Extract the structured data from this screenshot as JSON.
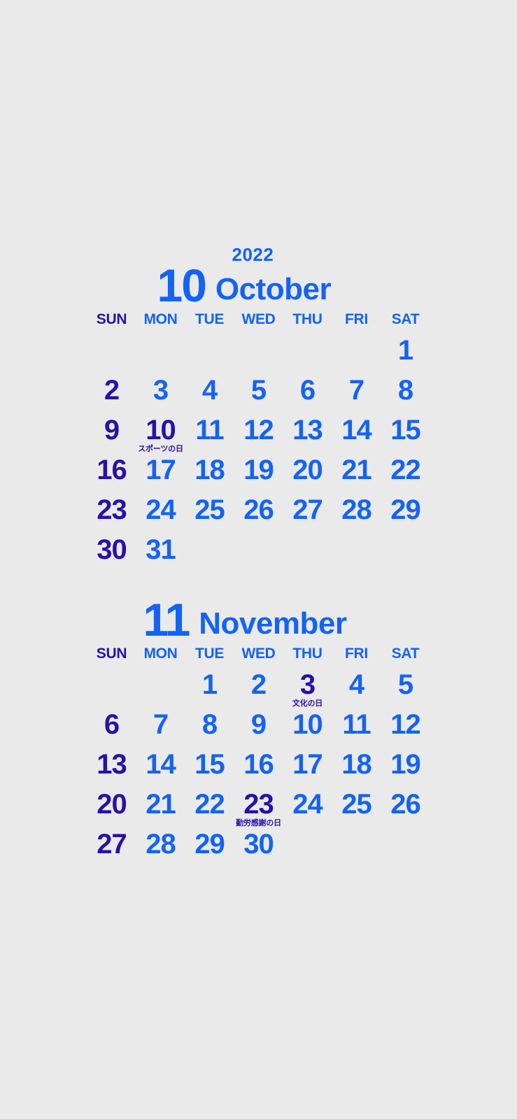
{
  "background_color": "#eaeaea",
  "colors": {
    "weekday_blue": "#1463f3",
    "sunday_holiday_purple": "#2a0fa8"
  },
  "weekday_headers": [
    "SUN",
    "MON",
    "TUE",
    "WED",
    "THU",
    "FRI",
    "SAT"
  ],
  "months": [
    {
      "year": "2022",
      "number": "10",
      "name": "October",
      "weeks": [
        [
          {
            "day": ""
          },
          {
            "day": ""
          },
          {
            "day": ""
          },
          {
            "day": ""
          },
          {
            "day": ""
          },
          {
            "day": ""
          },
          {
            "day": "1"
          }
        ],
        [
          {
            "day": "2"
          },
          {
            "day": "3"
          },
          {
            "day": "4"
          },
          {
            "day": "5"
          },
          {
            "day": "6"
          },
          {
            "day": "7"
          },
          {
            "day": "8"
          }
        ],
        [
          {
            "day": "9"
          },
          {
            "day": "10",
            "holiday": "スポーツの日"
          },
          {
            "day": "11"
          },
          {
            "day": "12"
          },
          {
            "day": "13"
          },
          {
            "day": "14"
          },
          {
            "day": "15"
          }
        ],
        [
          {
            "day": "16"
          },
          {
            "day": "17"
          },
          {
            "day": "18"
          },
          {
            "day": "19"
          },
          {
            "day": "20"
          },
          {
            "day": "21"
          },
          {
            "day": "22"
          }
        ],
        [
          {
            "day": "23"
          },
          {
            "day": "24"
          },
          {
            "day": "25"
          },
          {
            "day": "26"
          },
          {
            "day": "27"
          },
          {
            "day": "28"
          },
          {
            "day": "29"
          }
        ],
        [
          {
            "day": "30"
          },
          {
            "day": "31"
          },
          {
            "day": ""
          },
          {
            "day": ""
          },
          {
            "day": ""
          },
          {
            "day": ""
          },
          {
            "day": ""
          }
        ]
      ]
    },
    {
      "year": "",
      "number": "11",
      "name": "November",
      "weeks": [
        [
          {
            "day": ""
          },
          {
            "day": ""
          },
          {
            "day": "1"
          },
          {
            "day": "2"
          },
          {
            "day": "3",
            "holiday": "文化の日"
          },
          {
            "day": "4"
          },
          {
            "day": "5"
          }
        ],
        [
          {
            "day": "6"
          },
          {
            "day": "7"
          },
          {
            "day": "8"
          },
          {
            "day": "9"
          },
          {
            "day": "10"
          },
          {
            "day": "11"
          },
          {
            "day": "12"
          }
        ],
        [
          {
            "day": "13"
          },
          {
            "day": "14"
          },
          {
            "day": "15"
          },
          {
            "day": "16"
          },
          {
            "day": "17"
          },
          {
            "day": "18"
          },
          {
            "day": "19"
          }
        ],
        [
          {
            "day": "20"
          },
          {
            "day": "21"
          },
          {
            "day": "22"
          },
          {
            "day": "23",
            "holiday": "勤労感謝の日"
          },
          {
            "day": "24"
          },
          {
            "day": "25"
          },
          {
            "day": "26"
          }
        ],
        [
          {
            "day": "27"
          },
          {
            "day": "28"
          },
          {
            "day": "29"
          },
          {
            "day": "30"
          },
          {
            "day": ""
          },
          {
            "day": ""
          },
          {
            "day": ""
          }
        ]
      ]
    }
  ]
}
